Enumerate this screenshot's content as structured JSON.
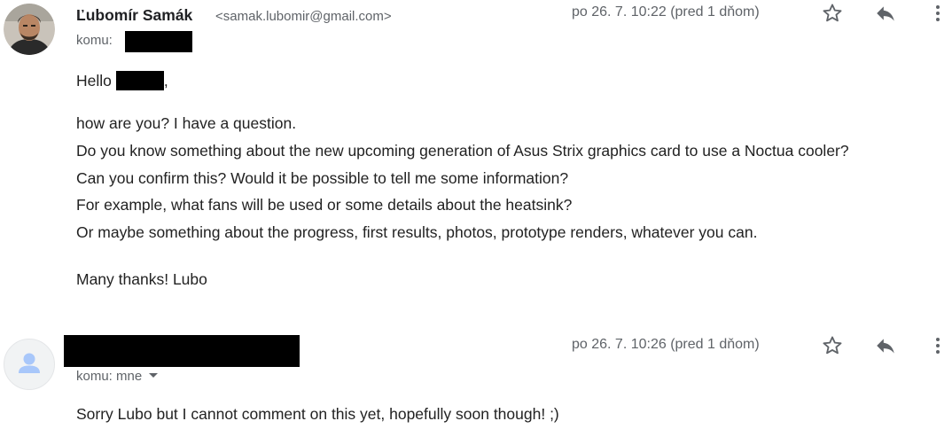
{
  "messages": [
    {
      "sender_name": "Ľubomír Samák",
      "sender_email": "<samak.lubomir@gmail.com>",
      "to_label": "komu:",
      "timestamp": "po 26. 7. 10:22 (pred 1 dňom)",
      "greeting": "Hello",
      "greeting_suffix": ",",
      "body_lines": [
        "how are you? I have a question.",
        "Do you know something about the new upcoming generation of Asus Strix graphics card to use a Noctua cooler?",
        "Can you confirm this? Would it be possible to tell me some information?",
        "For example, what fans will be used or some details about the heatsink?",
        "Or maybe something about the progress, first results, photos, prototype renders, whatever you can."
      ],
      "signoff": "Many thanks! Lubo"
    },
    {
      "to_label": "komu: mne",
      "timestamp": "po 26. 7. 10:26 (pred 1 dňom)",
      "body": "Sorry Lubo but I cannot comment on this yet, hopefully soon though! ;)"
    }
  ],
  "icons": {
    "star": "star-icon",
    "reply": "reply-icon",
    "more": "more-vert-icon",
    "avatar_default": "person-icon"
  },
  "colors": {
    "text": "#222222",
    "meta": "#5f6368",
    "redaction": "#000000"
  }
}
